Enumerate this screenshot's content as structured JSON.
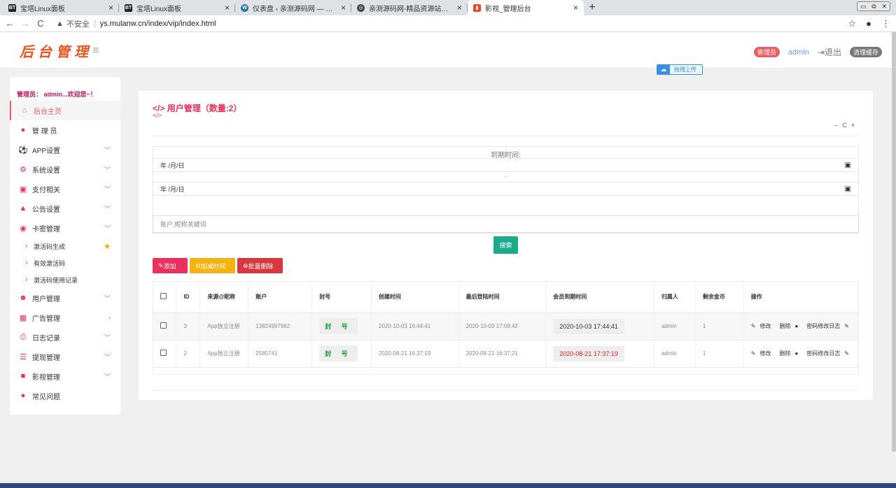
{
  "browser": {
    "tabs": [
      {
        "label": "宝塔Linux面板",
        "fav": "BT",
        "color": "#20a53a"
      },
      {
        "label": "宝塔Linux面板",
        "fav": "BT",
        "color": "#20a53a"
      },
      {
        "label": "仪表盘 ‹ 亲测源码网 — WordPre...",
        "fav": "W",
        "color": "#21759b"
      },
      {
        "label": "亲测源码网-精品资源站长亲测",
        "fav": "◎",
        "color": "#444"
      },
      {
        "label": "影视_管理后台",
        "fav": "▮",
        "color": "#e44d26"
      }
    ],
    "security": "不安全",
    "url": "ys.mulanw.cn/index/vip/index.html"
  },
  "header": {
    "logo": "后台管理",
    "role_badge": "管理员",
    "admin": "admin",
    "logout": "退出",
    "clear_cache": "清理缓存",
    "upload": "拖拽上传"
  },
  "sidebar": {
    "welcome": "管理员： admin...欢迎您~！",
    "items": [
      {
        "label": "后台主页",
        "icon": "home-icon"
      },
      {
        "label": "管 理 员",
        "icon": "user-icon"
      },
      {
        "label": "APP设置",
        "icon": "football-icon"
      },
      {
        "label": "系统设置",
        "icon": "gears-icon"
      },
      {
        "label": "支付相关",
        "icon": "money-icon"
      },
      {
        "label": "公告设置",
        "icon": "bell-icon"
      },
      {
        "label": "卡密管理",
        "icon": "globe-icon"
      },
      {
        "label": "激活码生成",
        "icon": "chevron-right-icon"
      },
      {
        "label": "有效激活码",
        "icon": "chevron-right-icon"
      },
      {
        "label": "激活码使用记录",
        "icon": "chevron-right-icon"
      },
      {
        "label": "用户管理",
        "icon": "users-icon"
      },
      {
        "label": "广告管理",
        "icon": "table-icon"
      },
      {
        "label": "日志记录",
        "icon": "printer-icon"
      },
      {
        "label": "提现管理",
        "icon": "list-icon"
      },
      {
        "label": "影视管理",
        "icon": "video-icon"
      },
      {
        "label": "常见问题",
        "icon": "user-icon"
      }
    ]
  },
  "content": {
    "title": "用户管理（数量:2）",
    "filter": {
      "expire_label": "到期时间:",
      "date_placeholder": "年 /月/日",
      "separator": "-",
      "search_placeholder": "账户,昵称关键词",
      "search_button": "搜索"
    },
    "actions": {
      "add": "添加",
      "add_time": "加减时间",
      "batch_delete": "批量删除"
    },
    "table": {
      "headers": [
        "ID",
        "来源@昵称",
        "账户",
        "封号",
        "创建时间",
        "最后登陆时间",
        "会员到期时间",
        "归属人",
        "剩余金币",
        "操作"
      ],
      "rows": [
        {
          "id": "3",
          "source": "App独立注册",
          "account": "13824997962",
          "ban": "封 号",
          "created": "2020-10-03 16:44:41",
          "last_login": "2020-10-03 17:09:42",
          "expire": "2020-10-03 17:44:41",
          "owner": "admin",
          "coins": "1"
        },
        {
          "id": "2",
          "source": "App独立注册",
          "account": "2580741",
          "ban": "封 号",
          "created": "2020-08-21 16:37:19",
          "last_login": "2020-08-21 16:37:21",
          "expire": "2020-08-21 17:37:19",
          "owner": "admin",
          "coins": "1"
        }
      ],
      "op_edit": "修改",
      "op_delete": "删除",
      "op_pwdlog": "密码修改日志"
    }
  }
}
